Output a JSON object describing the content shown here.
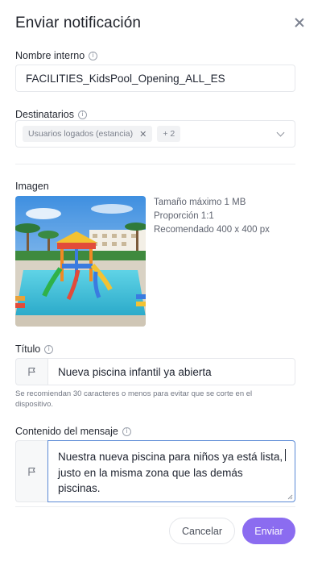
{
  "dialog": {
    "title": "Enviar notificación"
  },
  "internal_name": {
    "label": "Nombre interno",
    "value": "FACILITIES_KidsPool_Opening_ALL_ES"
  },
  "recipients": {
    "label": "Destinatarios",
    "chip": "Usuarios logados (estancia)",
    "more": "+ 2"
  },
  "image": {
    "label": "Imagen",
    "max_size": "Tamaño máximo 1 MB",
    "ratio": "Proporción 1:1",
    "recommended": "Recomendado 400 x 400 px"
  },
  "title_field": {
    "label": "Título",
    "value": "Nueva piscina infantil ya abierta",
    "hint": "Se recomiendan 30 caracteres o menos para evitar que se corte en el dispositivo."
  },
  "message": {
    "label": "Contenido del mensaje",
    "value": "Nuestra nueva piscina para niños ya está lista, justo en la misma zona que las demás piscinas."
  },
  "actions": {
    "cancel": "Cancelar",
    "send": "Enviar"
  },
  "colors": {
    "accent": "#8b6cf0",
    "focus_border": "#5b8ad6"
  }
}
